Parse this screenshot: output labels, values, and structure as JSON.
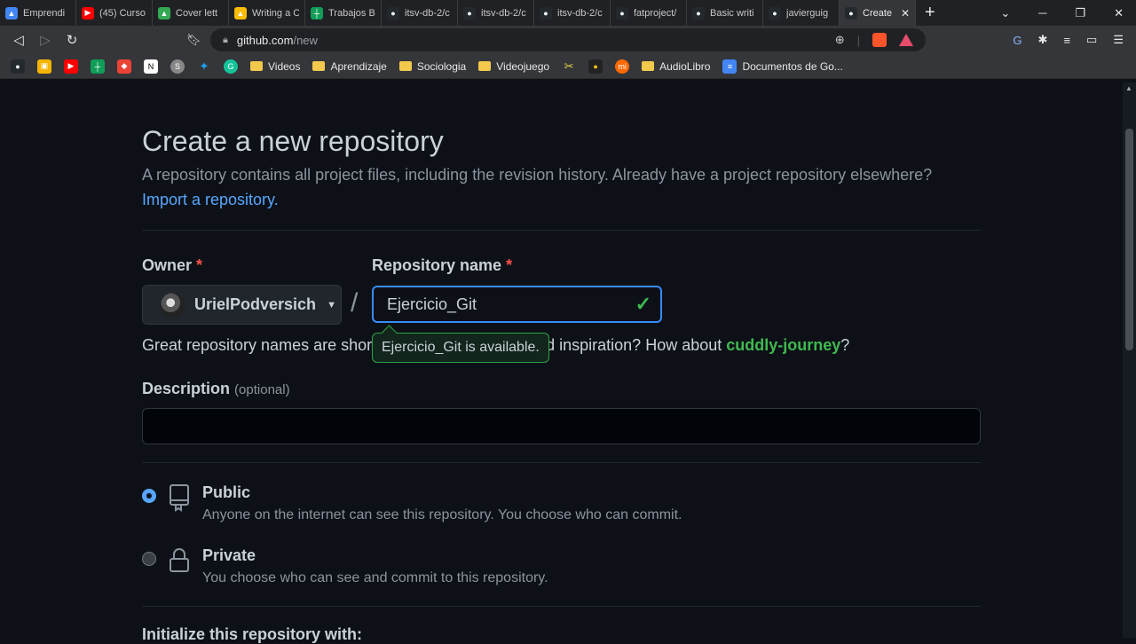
{
  "tabs": [
    {
      "title": "Emprendi",
      "color": "#4285f4",
      "glyph": "▲"
    },
    {
      "title": "(45) Curso",
      "color": "#ff0000",
      "glyph": "▶"
    },
    {
      "title": "Cover lett",
      "color": "#34a853",
      "glyph": "▲"
    },
    {
      "title": "Writing a C",
      "color": "#fbbc05",
      "glyph": "▲"
    },
    {
      "title": "Trabajos B",
      "color": "#0f9d58",
      "glyph": "┼"
    },
    {
      "title": "itsv-db-2/c",
      "color": "#24292e",
      "glyph": "●"
    },
    {
      "title": "itsv-db-2/c",
      "color": "#24292e",
      "glyph": "●"
    },
    {
      "title": "itsv-db-2/c",
      "color": "#24292e",
      "glyph": "●"
    },
    {
      "title": "fatproject/",
      "color": "#24292e",
      "glyph": "●"
    },
    {
      "title": "Basic writi",
      "color": "#24292e",
      "glyph": "●"
    },
    {
      "title": "javierguig",
      "color": "#24292e",
      "glyph": "●"
    },
    {
      "title": "Create",
      "color": "#24292e",
      "glyph": "●"
    }
  ],
  "address": {
    "host": "github.com",
    "path": "/new"
  },
  "bookmarks": [
    "Videos",
    "Aprendizaje",
    "Sociologia",
    "Videojuego",
    "AudioLibro",
    "Documentos de Go..."
  ],
  "page": {
    "title": "Create a new repository",
    "subtitle": "A repository contains all project files, including the revision history. Already have a project repository elsewhere?",
    "import_link": "Import a repository.",
    "owner_label": "Owner",
    "required_mark": "*",
    "repo_label": "Repository name",
    "owner_value": "UrielPodversich",
    "repo_value": "Ejercicio_Git",
    "great_prefix": "Great repository names are shor",
    "great_suffix": "d inspiration? How about",
    "suggestion": "cuddly-journey",
    "question_mark": "?",
    "tooltip": "Ejercicio_Git is available.",
    "description_label": "Description",
    "optional": "(optional)",
    "public_title": "Public",
    "public_desc": "Anyone on the internet can see this repository. You choose who can commit.",
    "private_title": "Private",
    "private_desc": "You choose who can see and commit to this repository.",
    "init_label": "Initialize this repository with:"
  },
  "colors": {
    "accent": "#58a6ff",
    "success": "#3fb950",
    "danger": "#f85149"
  }
}
